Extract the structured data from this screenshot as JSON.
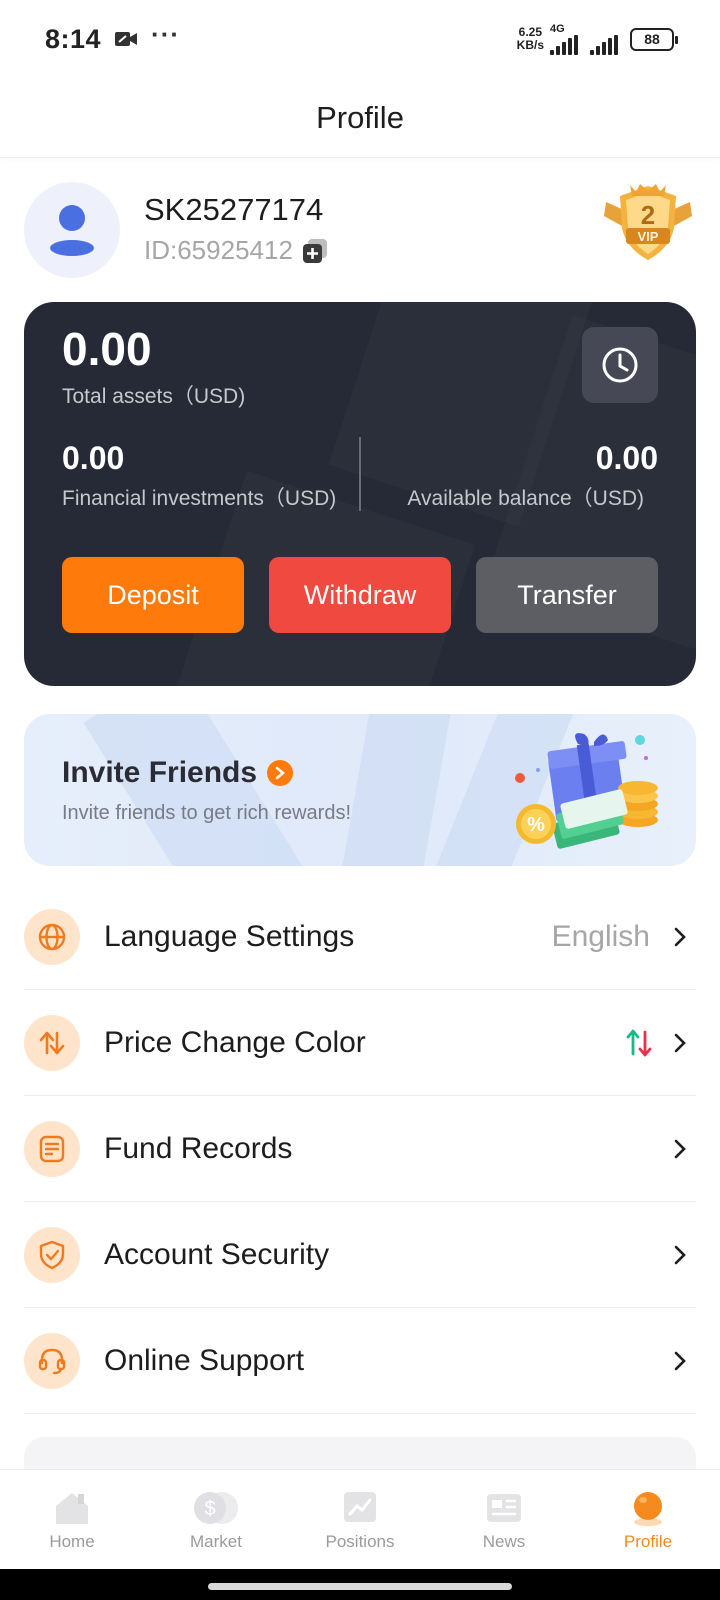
{
  "status_bar": {
    "time": "8:14",
    "net_speed": "6.25",
    "net_unit": "KB/s",
    "network_type": "4G",
    "battery": "88"
  },
  "header": {
    "title": "Profile"
  },
  "profile": {
    "username": "SK25277174",
    "user_id": "ID:65925412",
    "vip_level": "2",
    "vip_text": "VIP"
  },
  "assets": {
    "total_value": "0.00",
    "total_label": "Total assets（USD)",
    "financial_value": "0.00",
    "financial_label": "Financial investments（USD)",
    "balance_value": "0.00",
    "balance_label": "Available balance（USD)",
    "deposit_label": "Deposit",
    "withdraw_label": "Withdraw",
    "transfer_label": "Transfer"
  },
  "invite": {
    "title": "Invite Friends",
    "subtitle": "Invite friends to get rich rewards!"
  },
  "menu": {
    "items": [
      {
        "label": "Language Settings",
        "value": "English",
        "icon": "globe-icon"
      },
      {
        "label": "Price Change Color",
        "value": "",
        "icon": "swap-arrows-icon"
      },
      {
        "label": "Fund Records",
        "value": "",
        "icon": "document-icon"
      },
      {
        "label": "Account Security",
        "value": "",
        "icon": "shield-icon"
      },
      {
        "label": "Online Support",
        "value": "",
        "icon": "headset-icon"
      }
    ]
  },
  "nav": {
    "items": [
      {
        "label": "Home",
        "icon": "home-icon"
      },
      {
        "label": "Market",
        "icon": "market-icon"
      },
      {
        "label": "Positions",
        "icon": "positions-icon"
      },
      {
        "label": "News",
        "icon": "news-icon"
      },
      {
        "label": "Profile",
        "icon": "profile-icon"
      }
    ],
    "active": "Profile"
  },
  "colors": {
    "accent": "#fe7a0b",
    "withdraw": "#f04a40",
    "card_bg": "#262a36",
    "active_nav": "#f08c1e"
  }
}
